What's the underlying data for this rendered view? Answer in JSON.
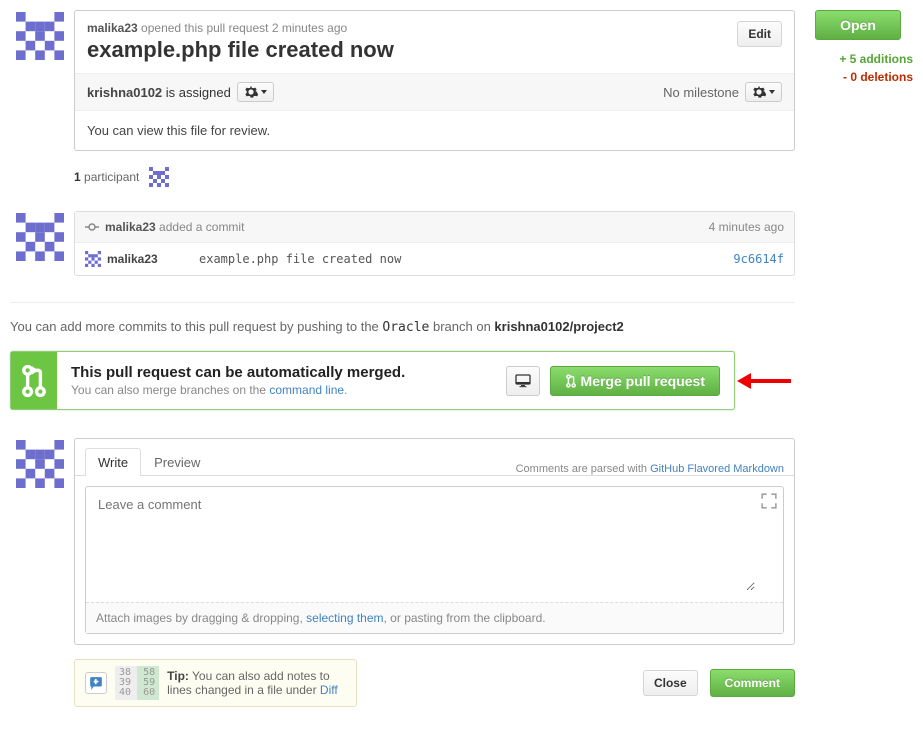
{
  "header": {
    "author": "malika23",
    "opened_text": " opened this pull request ",
    "opened_time": "2 minutes ago",
    "title": "example.php file created now",
    "edit_label": "Edit"
  },
  "meta": {
    "assignee": "krishna0102",
    "assigned_suffix": " is assigned",
    "no_milestone": "No milestone"
  },
  "body": {
    "text": "You can view this file for review."
  },
  "participants": {
    "count": "1",
    "label": " participant"
  },
  "commit_block": {
    "header_author": "malika23",
    "header_text": " added a commit",
    "header_time": "4 minutes ago",
    "row_author": "malika23",
    "row_msg": "example.php file created now",
    "row_sha": "9c6614f"
  },
  "push_hint": {
    "prefix": "You can add more commits to this pull request by pushing to the ",
    "branch": "Oracle",
    "middle": " branch on ",
    "repo": "krishna0102/project2"
  },
  "merge": {
    "headline": "This pull request can be automatically merged.",
    "sub_prefix": "You can also merge branches on the ",
    "sub_link": "command line",
    "button": "Merge pull request"
  },
  "comment": {
    "tab_write": "Write",
    "tab_preview": "Preview",
    "hint_prefix": "Comments are parsed with ",
    "hint_link": "GitHub Flavored Markdown",
    "placeholder": "Leave a comment",
    "attach_prefix": "Attach images by dragging & dropping, ",
    "attach_link": "selecting them",
    "attach_suffix": ", or pasting from the clipboard."
  },
  "tip": {
    "nums": "38  58\n39  59\n40  60",
    "label": "Tip:",
    "text_prefix": " You can also add notes to lines changed in a file under ",
    "link": "Diff"
  },
  "actions": {
    "close": "Close",
    "comment": "Comment"
  },
  "side": {
    "open": "Open",
    "additions": "+ 5 additions",
    "deletions": "- 0 deletions"
  }
}
